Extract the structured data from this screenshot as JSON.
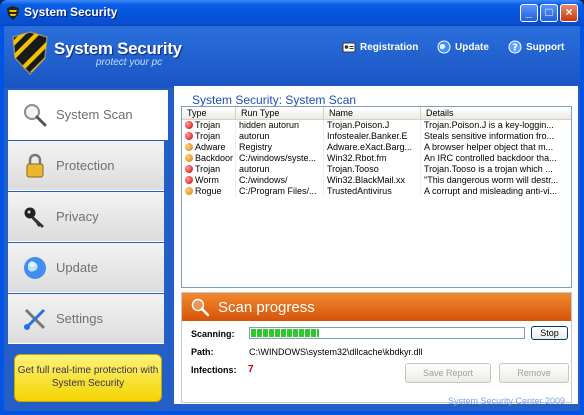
{
  "window": {
    "title": "System Security",
    "controls": {
      "minimize": "_",
      "maximize": "□",
      "close": "×"
    }
  },
  "header": {
    "brand": "System Security",
    "tagline": "protect your pc",
    "links": [
      {
        "label": "Registration",
        "icon": "id-card-icon"
      },
      {
        "label": "Update",
        "icon": "globe-icon"
      },
      {
        "label": "Support",
        "icon": "help-icon"
      }
    ]
  },
  "sidebar": {
    "items": [
      {
        "label": "System Scan",
        "icon": "magnifier-icon",
        "active": true
      },
      {
        "label": "Protection",
        "icon": "padlock-icon",
        "active": false
      },
      {
        "label": "Privacy",
        "icon": "key-icon",
        "active": false
      },
      {
        "label": "Update",
        "icon": "globe-icon",
        "active": false
      },
      {
        "label": "Settings",
        "icon": "tools-icon",
        "active": false
      }
    ],
    "promo": "Get full real-time protection with System Security"
  },
  "main": {
    "title": "System Security: System Scan",
    "table": {
      "columns": [
        "Type",
        "Run Type",
        "Name",
        "Details"
      ],
      "rows": [
        {
          "severity": "red",
          "type": "Trojan",
          "run_type": "hidden autorun",
          "name": "Trojan.Poison.J",
          "details": "Trojan.Poison.J is a key-loggin..."
        },
        {
          "severity": "red",
          "type": "Trojan",
          "run_type": "autorun",
          "name": "Infostealer.Banker.E",
          "details": "Steals sensitive information fro..."
        },
        {
          "severity": "orange",
          "type": "Adware",
          "run_type": "Registry",
          "name": "Adware.eXact.Barg...",
          "details": "A browser helper object that m..."
        },
        {
          "severity": "orange",
          "type": "Backdoor",
          "run_type": "C:/windows/syste...",
          "name": "Win32.Rbot.fm",
          "details": "An IRC controlled backdoor tha..."
        },
        {
          "severity": "red",
          "type": "Trojan",
          "run_type": "autorun",
          "name": "Trojan.Tooso",
          "details": "Trojan.Tooso is a trojan which ..."
        },
        {
          "severity": "red",
          "type": "Worm",
          "run_type": "C:/windows/",
          "name": "Win32.BlackMail.xx",
          "details": "\"This dangerous worm will destr..."
        },
        {
          "severity": "orange",
          "type": "Rogue",
          "run_type": "C:/Program Files/...",
          "name": "TrustedAntivirus",
          "details": "A corrupt and misleading anti-vi..."
        }
      ]
    },
    "progress": {
      "title": "Scan progress",
      "scanning_label": "Scanning:",
      "scan_fraction": 0.25,
      "stop_label": "Stop",
      "path_label": "Path:",
      "path_value": "C:\\WINDOWS\\system32\\dllcache\\kbdkyr.dll",
      "infections_label": "Infections:",
      "infections_count": "7",
      "save_report_label": "Save Report",
      "remove_label": "Remove"
    }
  },
  "footer": {
    "text": "System Security Center 2009"
  },
  "colors": {
    "accent": "#1d4fb8",
    "progress_header": "#e06a1a",
    "progress_fill": "#2fc82f",
    "infections": "#cc0000"
  }
}
